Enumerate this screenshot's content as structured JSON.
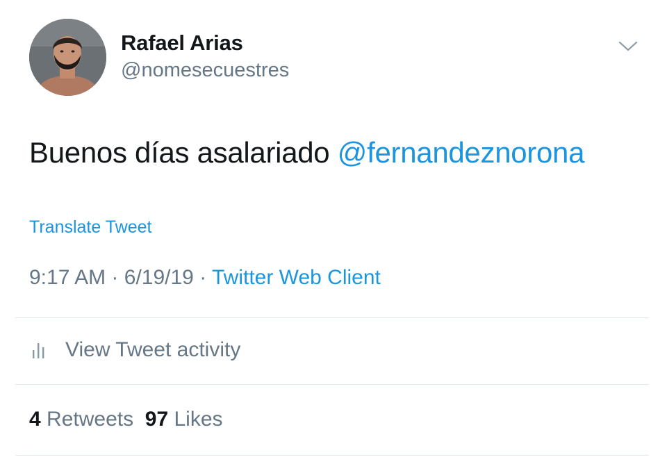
{
  "author": {
    "display_name": "Rafael Arias",
    "handle": "@nomesecuestres",
    "avatar_icon": "avatar"
  },
  "tweet": {
    "text": "Buenos días asalariado",
    "mention": "@fernandeznorona",
    "translate_label": "Translate Tweet",
    "time": "9:17 AM",
    "separator": "·",
    "date": "6/19/19",
    "client": "Twitter Web Client"
  },
  "activity": {
    "label": "View Tweet activity",
    "icon": "bar-chart-icon"
  },
  "stats": {
    "retweets_count": "4",
    "retweets_label": "Retweets",
    "likes_count": "97",
    "likes_label": "Likes"
  },
  "colors": {
    "link": "#1b95e0",
    "secondary_text": "#657786",
    "primary_text": "#14171a",
    "divider": "#e1e8ed"
  }
}
